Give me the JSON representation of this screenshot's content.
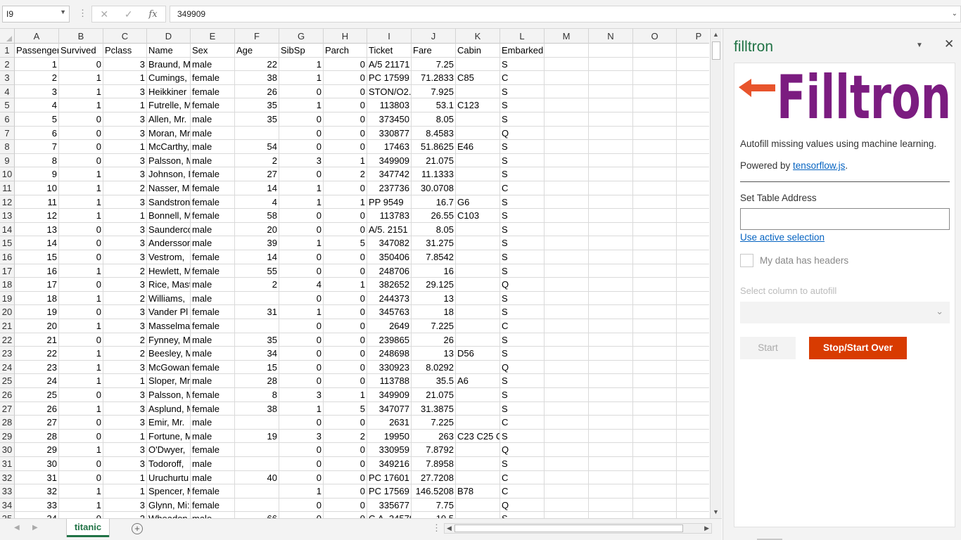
{
  "formula_bar": {
    "name_box": "I9",
    "cancel_icon": "✕",
    "confirm_icon": "✓",
    "fx_label": "fx",
    "value": "349909"
  },
  "grid": {
    "columns": [
      "A",
      "B",
      "C",
      "D",
      "E",
      "F",
      "G",
      "H",
      "I",
      "J",
      "K",
      "L",
      "M",
      "N",
      "O",
      "P"
    ],
    "rows": [
      {
        "n": "1",
        "cells": [
          "Passenger",
          "Survived",
          "Pclass",
          "Name",
          "Sex",
          "Age",
          "SibSp",
          "Parch",
          "Ticket",
          "Fare",
          "Cabin",
          "Embarked"
        ]
      },
      {
        "n": "2",
        "cells": [
          "1",
          "0",
          "3",
          "Braund, M",
          "male",
          "22",
          "1",
          "0",
          "A/5 21171",
          "7.25",
          "",
          "S"
        ]
      },
      {
        "n": "3",
        "cells": [
          "2",
          "1",
          "1",
          "Cumings,",
          "female",
          "38",
          "1",
          "0",
          "PC 17599",
          "71.2833",
          "C85",
          "C"
        ]
      },
      {
        "n": "4",
        "cells": [
          "3",
          "1",
          "3",
          "Heikkiner",
          "female",
          "26",
          "0",
          "0",
          "STON/O2.",
          "7.925",
          "",
          "S"
        ]
      },
      {
        "n": "5",
        "cells": [
          "4",
          "1",
          "1",
          "Futrelle, M",
          "female",
          "35",
          "1",
          "0",
          "113803",
          "53.1",
          "C123",
          "S"
        ]
      },
      {
        "n": "6",
        "cells": [
          "5",
          "0",
          "3",
          "Allen, Mr.",
          "male",
          "35",
          "0",
          "0",
          "373450",
          "8.05",
          "",
          "S"
        ]
      },
      {
        "n": "7",
        "cells": [
          "6",
          "0",
          "3",
          "Moran, Mr",
          "male",
          "",
          "0",
          "0",
          "330877",
          "8.4583",
          "",
          "Q"
        ]
      },
      {
        "n": "8",
        "cells": [
          "7",
          "0",
          "1",
          "McCarthy,",
          "male",
          "54",
          "0",
          "0",
          "17463",
          "51.8625",
          "E46",
          "S"
        ]
      },
      {
        "n": "9",
        "cells": [
          "8",
          "0",
          "3",
          "Palsson, M",
          "male",
          "2",
          "3",
          "1",
          "349909",
          "21.075",
          "",
          "S"
        ]
      },
      {
        "n": "10",
        "cells": [
          "9",
          "1",
          "3",
          "Johnson, I",
          "female",
          "27",
          "0",
          "2",
          "347742",
          "11.1333",
          "",
          "S"
        ]
      },
      {
        "n": "11",
        "cells": [
          "10",
          "1",
          "2",
          "Nasser, M",
          "female",
          "14",
          "1",
          "0",
          "237736",
          "30.0708",
          "",
          "C"
        ]
      },
      {
        "n": "12",
        "cells": [
          "11",
          "1",
          "3",
          "Sandstron",
          "female",
          "4",
          "1",
          "1",
          "PP 9549",
          "16.7",
          "G6",
          "S"
        ]
      },
      {
        "n": "13",
        "cells": [
          "12",
          "1",
          "1",
          "Bonnell, M",
          "female",
          "58",
          "0",
          "0",
          "113783",
          "26.55",
          "C103",
          "S"
        ]
      },
      {
        "n": "14",
        "cells": [
          "13",
          "0",
          "3",
          "Saunderco",
          "male",
          "20",
          "0",
          "0",
          "A/5. 2151",
          "8.05",
          "",
          "S"
        ]
      },
      {
        "n": "15",
        "cells": [
          "14",
          "0",
          "3",
          "Andersson",
          "male",
          "39",
          "1",
          "5",
          "347082",
          "31.275",
          "",
          "S"
        ]
      },
      {
        "n": "16",
        "cells": [
          "15",
          "0",
          "3",
          "Vestrom,",
          "female",
          "14",
          "0",
          "0",
          "350406",
          "7.8542",
          "",
          "S"
        ]
      },
      {
        "n": "17",
        "cells": [
          "16",
          "1",
          "2",
          "Hewlett, M",
          "female",
          "55",
          "0",
          "0",
          "248706",
          "16",
          "",
          "S"
        ]
      },
      {
        "n": "18",
        "cells": [
          "17",
          "0",
          "3",
          "Rice, Mast",
          "male",
          "2",
          "4",
          "1",
          "382652",
          "29.125",
          "",
          "Q"
        ]
      },
      {
        "n": "19",
        "cells": [
          "18",
          "1",
          "2",
          "Williams,",
          "male",
          "",
          "0",
          "0",
          "244373",
          "13",
          "",
          "S"
        ]
      },
      {
        "n": "20",
        "cells": [
          "19",
          "0",
          "3",
          "Vander Pl",
          "female",
          "31",
          "1",
          "0",
          "345763",
          "18",
          "",
          "S"
        ]
      },
      {
        "n": "21",
        "cells": [
          "20",
          "1",
          "3",
          "Masselma",
          "female",
          "",
          "0",
          "0",
          "2649",
          "7.225",
          "",
          "C"
        ]
      },
      {
        "n": "22",
        "cells": [
          "21",
          "0",
          "2",
          "Fynney, M",
          "male",
          "35",
          "0",
          "0",
          "239865",
          "26",
          "",
          "S"
        ]
      },
      {
        "n": "23",
        "cells": [
          "22",
          "1",
          "2",
          "Beesley, M",
          "male",
          "34",
          "0",
          "0",
          "248698",
          "13",
          "D56",
          "S"
        ]
      },
      {
        "n": "24",
        "cells": [
          "23",
          "1",
          "3",
          "McGowan",
          "female",
          "15",
          "0",
          "0",
          "330923",
          "8.0292",
          "",
          "Q"
        ]
      },
      {
        "n": "25",
        "cells": [
          "24",
          "1",
          "1",
          "Sloper, Mr",
          "male",
          "28",
          "0",
          "0",
          "113788",
          "35.5",
          "A6",
          "S"
        ]
      },
      {
        "n": "26",
        "cells": [
          "25",
          "0",
          "3",
          "Palsson, M",
          "female",
          "8",
          "3",
          "1",
          "349909",
          "21.075",
          "",
          "S"
        ]
      },
      {
        "n": "27",
        "cells": [
          "26",
          "1",
          "3",
          "Asplund, M",
          "female",
          "38",
          "1",
          "5",
          "347077",
          "31.3875",
          "",
          "S"
        ]
      },
      {
        "n": "28",
        "cells": [
          "27",
          "0",
          "3",
          "Emir, Mr.",
          "male",
          "",
          "0",
          "0",
          "2631",
          "7.225",
          "",
          "C"
        ]
      },
      {
        "n": "29",
        "cells": [
          "28",
          "0",
          "1",
          "Fortune, M",
          "male",
          "19",
          "3",
          "2",
          "19950",
          "263",
          "C23 C25 C2",
          "S"
        ]
      },
      {
        "n": "30",
        "cells": [
          "29",
          "1",
          "3",
          "O'Dwyer,",
          "female",
          "",
          "0",
          "0",
          "330959",
          "7.8792",
          "",
          "Q"
        ]
      },
      {
        "n": "31",
        "cells": [
          "30",
          "0",
          "3",
          "Todoroff,",
          "male",
          "",
          "0",
          "0",
          "349216",
          "7.8958",
          "",
          "S"
        ]
      },
      {
        "n": "32",
        "cells": [
          "31",
          "0",
          "1",
          "Uruchurtu",
          "male",
          "40",
          "0",
          "0",
          "PC 17601",
          "27.7208",
          "",
          "C"
        ]
      },
      {
        "n": "33",
        "cells": [
          "32",
          "1",
          "1",
          "Spencer, M",
          "female",
          "",
          "1",
          "0",
          "PC 17569",
          "146.5208",
          "B78",
          "C"
        ]
      },
      {
        "n": "34",
        "cells": [
          "33",
          "1",
          "3",
          "Glynn, Mi:",
          "female",
          "",
          "0",
          "0",
          "335677",
          "7.75",
          "",
          "Q"
        ]
      },
      {
        "n": "35",
        "cells": [
          "34",
          "0",
          "2",
          "Wheadon,",
          "male",
          "66",
          "0",
          "0",
          "C.A. 24579",
          "10.5",
          "",
          "S"
        ]
      }
    ]
  },
  "sheet_tabs": {
    "active": "titanic",
    "add_label": "+"
  },
  "taskpane": {
    "title": "filltron",
    "logo_text": "Filltron",
    "description": "Autofill missing values using machine learning.",
    "powered_prefix": "Powered by ",
    "powered_link": "tensorflow.js",
    "powered_suffix": ".",
    "table_address_label": "Set Table Address",
    "table_address_value": "",
    "use_active_selection": "Use active selection",
    "headers_checkbox_label": "My data has headers",
    "headers_checked": false,
    "select_column_label": "Select column to autofill",
    "select_column_value": "",
    "start_button": "Start",
    "stop_button": "Stop/Start Over",
    "colors": {
      "brand_purple": "#7b1c80",
      "brand_red": "#e8542c",
      "stop_button": "#d83b01",
      "excel_green": "#217346"
    }
  }
}
